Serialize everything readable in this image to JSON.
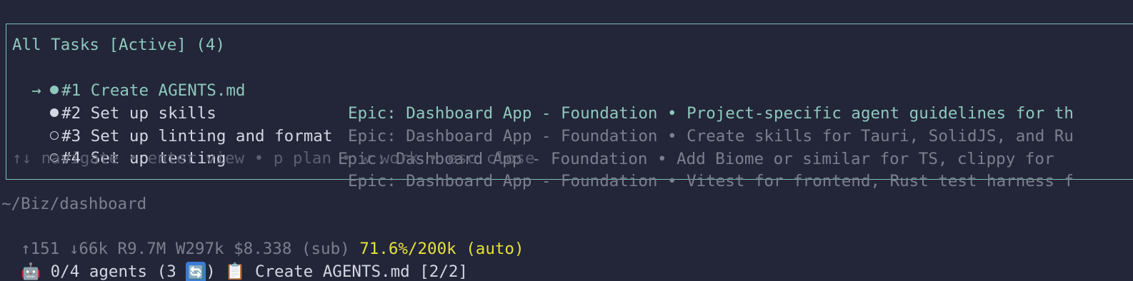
{
  "panel": {
    "title": "All Tasks [Active] (4)",
    "selector_arrow": "→",
    "tasks": [
      {
        "id": "#1 Create AGENTS.md",
        "status": "in-progress",
        "bullet_color": "#8ec8bd",
        "epic": "Epic: Dashboard App - Foundation",
        "sep": "•",
        "desc": "Project-specific agent guidelines for th",
        "selected": true
      },
      {
        "id": "#2 Set up skills",
        "status": "pending-filled",
        "bullet_color": "#d4d6e2",
        "epic": "Epic: Dashboard App - Foundation",
        "sep": "•",
        "desc": "Create skills for Tauri, SolidJS, and Ru",
        "selected": false
      },
      {
        "id": "#3 Set up linting and format",
        "status": "open",
        "bullet_color": "",
        "epic": "Epic: Dashboard App - Foundation",
        "sep": "•",
        "desc": "Add Biome or similar for TS, clippy for",
        "selected": false
      },
      {
        "id": "#4 Set up testing",
        "status": "open",
        "bullet_color": "",
        "epic": "Epic: Dashboard App - Foundation",
        "sep": "•",
        "desc": "Vitest for frontend, Rust test harness f",
        "selected": false
      }
    ],
    "help": "↑↓ navigate • enter view • p plan • w work • esc close"
  },
  "status": {
    "cwd": "~/Biz/dashboard",
    "usage": "↑151 ↓66k R9.7M W297k $8.338 (sub)",
    "context": "71.6%/200k (auto)",
    "agents_icon": "robot-icon",
    "agents_text": "0/4 agents (3",
    "agents_refresh_icon": "refresh-icon",
    "agents_close": ")",
    "clipboard_icon": "clipboard-icon",
    "current_task": "Create AGENTS.md [2/2]"
  },
  "colors": {
    "background": "#232638",
    "accent": "#8ec8bd",
    "context_yellow": "#e6e03a"
  }
}
